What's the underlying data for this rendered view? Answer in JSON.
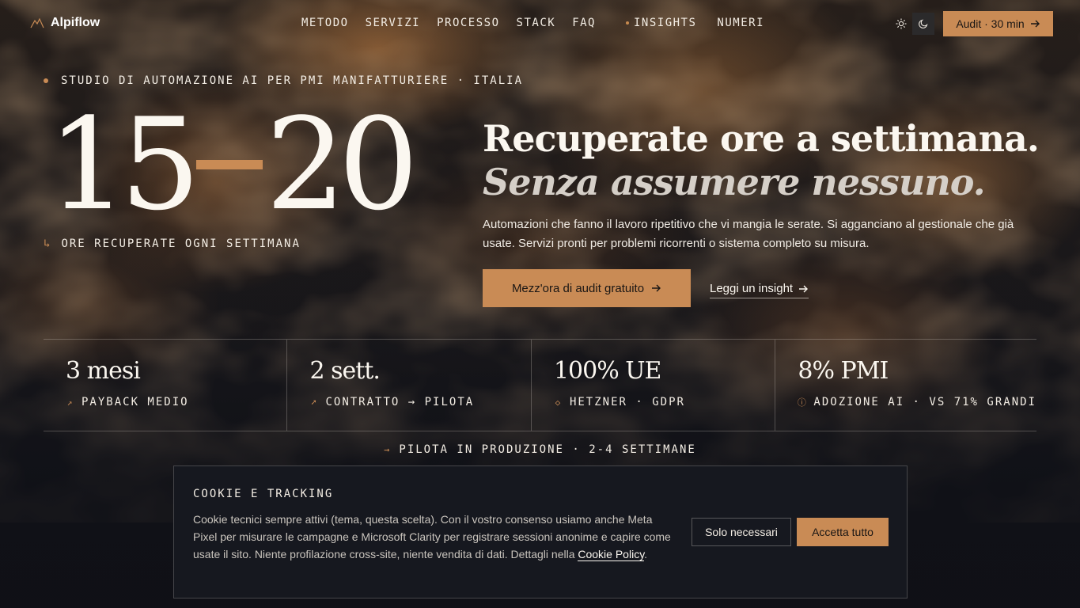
{
  "brand": {
    "name": "Alpiflow",
    "accent": "#c98b55",
    "logo_icon": "mountain-icon"
  },
  "nav": {
    "items": [
      {
        "label": "METODO",
        "dot": false
      },
      {
        "label": "SERVIZI",
        "dot": false
      },
      {
        "label": "PROCESSO",
        "dot": false
      },
      {
        "label": "STACK",
        "dot": false
      },
      {
        "label": "FAQ",
        "dot": false
      },
      {
        "label": "INSIGHTS",
        "dot": true
      },
      {
        "label": "NUMERI",
        "dot": true
      }
    ]
  },
  "theme": {
    "light_icon": "sun-icon",
    "dark_icon": "moon-icon",
    "active": "dark"
  },
  "header_cta": {
    "label": "Audit · 30 min",
    "icon": "arrow-right-icon"
  },
  "hero": {
    "eyebrow": "STUDIO DI AUTOMAZIONE AI PER PMI MANIFATTURIERE · ITALIA",
    "bignum_from": "15",
    "bignum_to": "20",
    "bignum_label": "ORE RECUPERATE OGNI SETTIMANA",
    "bignum_label_icon": "↳",
    "headline_1": "Recuperate ore a settimana.",
    "headline_2": "Senza assumere nessuno.",
    "lede": "Automazioni che fanno il lavoro ripetitivo che vi mangia le serate. Si agganciano al gestionale che già usate. Servizi pronti per problemi ricorrenti o sistema completo su misura.",
    "cta_primary": "Mezz'ora di audit gratuito",
    "cta_secondary": "Leggi un insight"
  },
  "stats": [
    {
      "value": "3 mesi",
      "label": "PAYBACK MEDIO",
      "icon": "trend-up-icon",
      "glyph": "↗"
    },
    {
      "value": "2 sett.",
      "label": "CONTRATTO → PILOTA",
      "icon": "rocket-icon",
      "glyph": "➚"
    },
    {
      "value": "100% UE",
      "label": "HETZNER · GDPR",
      "icon": "shield-icon",
      "glyph": "◇"
    },
    {
      "value": "8% PMI",
      "label": "ADOZIONE AI · VS 71% GRANDI",
      "icon": "info-icon",
      "glyph": "ⓘ"
    }
  ],
  "pilot": {
    "label": "PILOTA IN PRODUZIONE · 2-4 SETTIMANE",
    "icon": "→"
  },
  "cookie": {
    "title": "COOKIE E TRACKING",
    "text": "Cookie tecnici sempre attivi (tema, questa scelta). Con il vostro consenso usiamo anche Meta Pixel per misurare le campagne e Microsoft Clarity per registrare sessioni anonime e capire come usate il sito. Niente profilazione cross-site, niente vendita di dati. Dettagli nella ",
    "link": "Cookie Policy",
    "tail": ".",
    "btn_necessary": "Solo necessari",
    "btn_accept": "Accetta tutto"
  }
}
